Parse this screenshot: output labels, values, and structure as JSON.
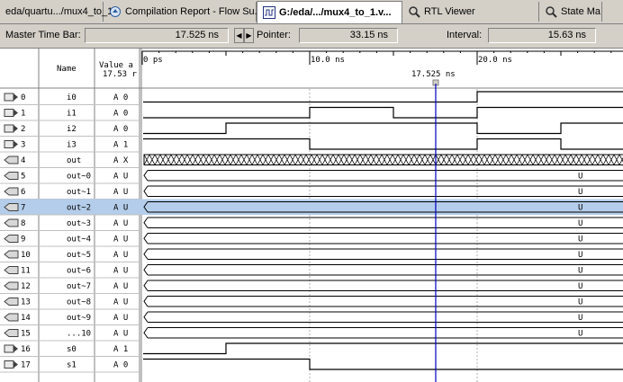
{
  "tabs": [
    {
      "label": "eda/quartu.../mux4_to_1.v",
      "icon": "document-icon",
      "active": false
    },
    {
      "label": "Compilation Report - Flow Su...",
      "icon": "report-icon",
      "active": false
    },
    {
      "label": "G:/eda/.../mux4_to_1.v...",
      "icon": "waveform-icon",
      "active": true
    },
    {
      "label": "RTL Viewer",
      "icon": "rtl-icon",
      "active": false
    },
    {
      "label": "State Ma",
      "icon": "state-machine-icon",
      "active": false
    }
  ],
  "toolbar": {
    "master_time_bar_label": "Master Time Bar:",
    "master_time_bar_value": "17.525 ns",
    "pointer_label": "Pointer:",
    "pointer_value": "33.15 ns",
    "interval_label": "Interval:",
    "interval_value": "15.63 ns"
  },
  "header": {
    "name_label": "Name",
    "value_label_1": "Value a",
    "value_label_2": "17.53 r"
  },
  "timeline": {
    "ticks": [
      "0 ps",
      "10.0 ns",
      "20.0 ns"
    ],
    "time_unit_end_ns": 24,
    "marker_label": "17.525 ns",
    "marker_ns": 17.525
  },
  "colors": {
    "selected_row": "#b4cdea",
    "time_bar": "#0000c0",
    "grid": "#b0b0b0"
  },
  "signals": [
    {
      "index": "0",
      "name": "i0",
      "value": "A 0",
      "kind": "input",
      "transitions": [
        [
          0,
          0
        ],
        [
          20,
          1
        ]
      ]
    },
    {
      "index": "1",
      "name": "i1",
      "value": "A 0",
      "kind": "input",
      "transitions": [
        [
          0,
          0
        ],
        [
          10,
          1
        ],
        [
          15,
          0
        ],
        [
          20,
          1
        ]
      ]
    },
    {
      "index": "2",
      "name": "i2",
      "value": "A 0",
      "kind": "input",
      "transitions": [
        [
          0,
          0
        ],
        [
          5,
          1
        ],
        [
          20,
          0
        ],
        [
          25,
          1
        ]
      ]
    },
    {
      "index": "3",
      "name": "i3",
      "value": "A 1",
      "kind": "input",
      "transitions": [
        [
          0,
          1
        ],
        [
          10,
          0
        ],
        [
          20,
          1
        ],
        [
          25,
          0
        ]
      ]
    },
    {
      "index": "4",
      "name": "out",
      "value": "A X",
      "kind": "output",
      "bus": "x"
    },
    {
      "index": "5",
      "name": "out~0",
      "value": "A U",
      "kind": "output",
      "bus": "U"
    },
    {
      "index": "6",
      "name": "out~1",
      "value": "A U",
      "kind": "output",
      "bus": "U"
    },
    {
      "index": "7",
      "name": "out~2",
      "value": "A U",
      "kind": "output",
      "bus": "U",
      "selected": true
    },
    {
      "index": "8",
      "name": "out~3",
      "value": "A U",
      "kind": "output",
      "bus": "U"
    },
    {
      "index": "9",
      "name": "out~4",
      "value": "A U",
      "kind": "output",
      "bus": "U"
    },
    {
      "index": "10",
      "name": "out~5",
      "value": "A U",
      "kind": "output",
      "bus": "U"
    },
    {
      "index": "11",
      "name": "out~6",
      "value": "A U",
      "kind": "output",
      "bus": "U"
    },
    {
      "index": "12",
      "name": "out~7",
      "value": "A U",
      "kind": "output",
      "bus": "U"
    },
    {
      "index": "13",
      "name": "out~8",
      "value": "A U",
      "kind": "output",
      "bus": "U"
    },
    {
      "index": "14",
      "name": "out~9",
      "value": "A U",
      "kind": "output",
      "bus": "U"
    },
    {
      "index": "15",
      "name": "...10",
      "value": "A U",
      "kind": "output",
      "bus": "U"
    },
    {
      "index": "16",
      "name": "s0",
      "value": "A 1",
      "kind": "input",
      "transitions": [
        [
          0,
          0
        ],
        [
          5,
          1
        ]
      ]
    },
    {
      "index": "17",
      "name": "s1",
      "value": "A 0",
      "kind": "input",
      "transitions": [
        [
          0,
          1
        ],
        [
          10,
          0
        ]
      ]
    }
  ]
}
